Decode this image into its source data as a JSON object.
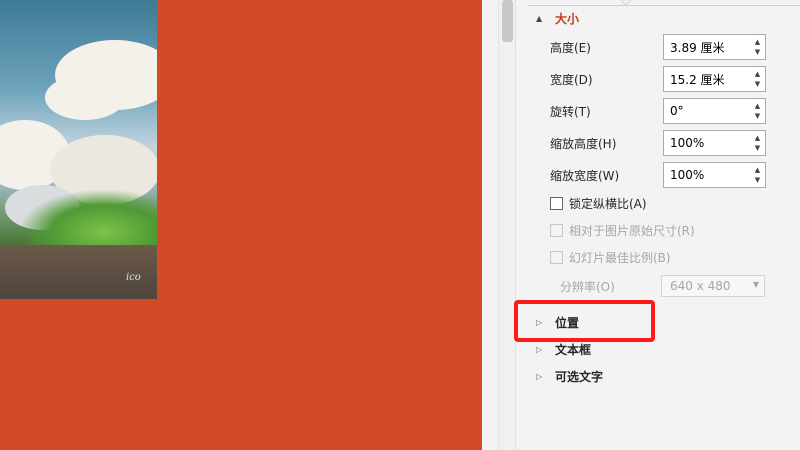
{
  "size_section": {
    "title": "大小",
    "fields": [
      {
        "label": "高度(E)",
        "value": "3.89 厘米"
      },
      {
        "label": "宽度(D)",
        "value": "15.2 厘米"
      },
      {
        "label": "旋转(T)",
        "value": "0°"
      },
      {
        "label": "缩放高度(H)",
        "value": "100%"
      },
      {
        "label": "缩放宽度(W)",
        "value": "100%"
      }
    ],
    "lock_aspect_ratio": {
      "label": "锁定纵横比(A)",
      "checked": false,
      "enabled": true
    },
    "relative_to_original": {
      "label": "相对于图片原始尺寸(R)",
      "checked": false,
      "enabled": false
    },
    "best_scale_slideshow": {
      "label": "幻灯片最佳比例(B)",
      "checked": false,
      "enabled": false
    },
    "resolution": {
      "label": "分辨率(O)",
      "value": "640 x 480",
      "enabled": false
    }
  },
  "collapsed_sections": [
    {
      "title": "位置"
    },
    {
      "title": "文本框"
    },
    {
      "title": "可选文字"
    }
  ],
  "image": {
    "signature": "ico"
  },
  "colors": {
    "slide_background": "#d34a26",
    "section_accent": "#c4391c",
    "highlight": "#ff1a1a",
    "pane_background": "#f3f3f3"
  },
  "icons": {
    "expanded": "triangle-down-icon",
    "collapsed": "triangle-right-icon",
    "spin": "spin-up-down-icon",
    "dropdown": "chevron-down-icon"
  }
}
